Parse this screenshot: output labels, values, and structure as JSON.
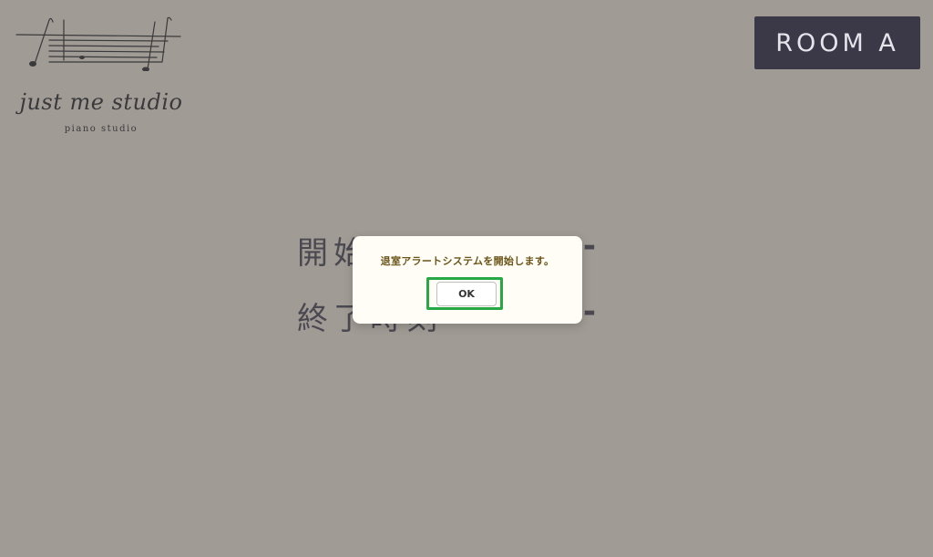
{
  "logo": {
    "name": "just me studio",
    "subtitle": "piano studio",
    "icon": "music-staff-icon"
  },
  "room": {
    "label": "ROOM A"
  },
  "schedule": {
    "start": {
      "label": "開始時刻",
      "value": "--:--"
    },
    "end": {
      "label": "終了時刻",
      "value": "--:--"
    }
  },
  "dialog": {
    "message": "退室アラートシステムを開始します。",
    "ok_label": "OK",
    "highlight_color": "#28a745"
  },
  "colors": {
    "background": "#a09b94",
    "badge": "#3b3848",
    "dialog_text": "#6b5418"
  }
}
